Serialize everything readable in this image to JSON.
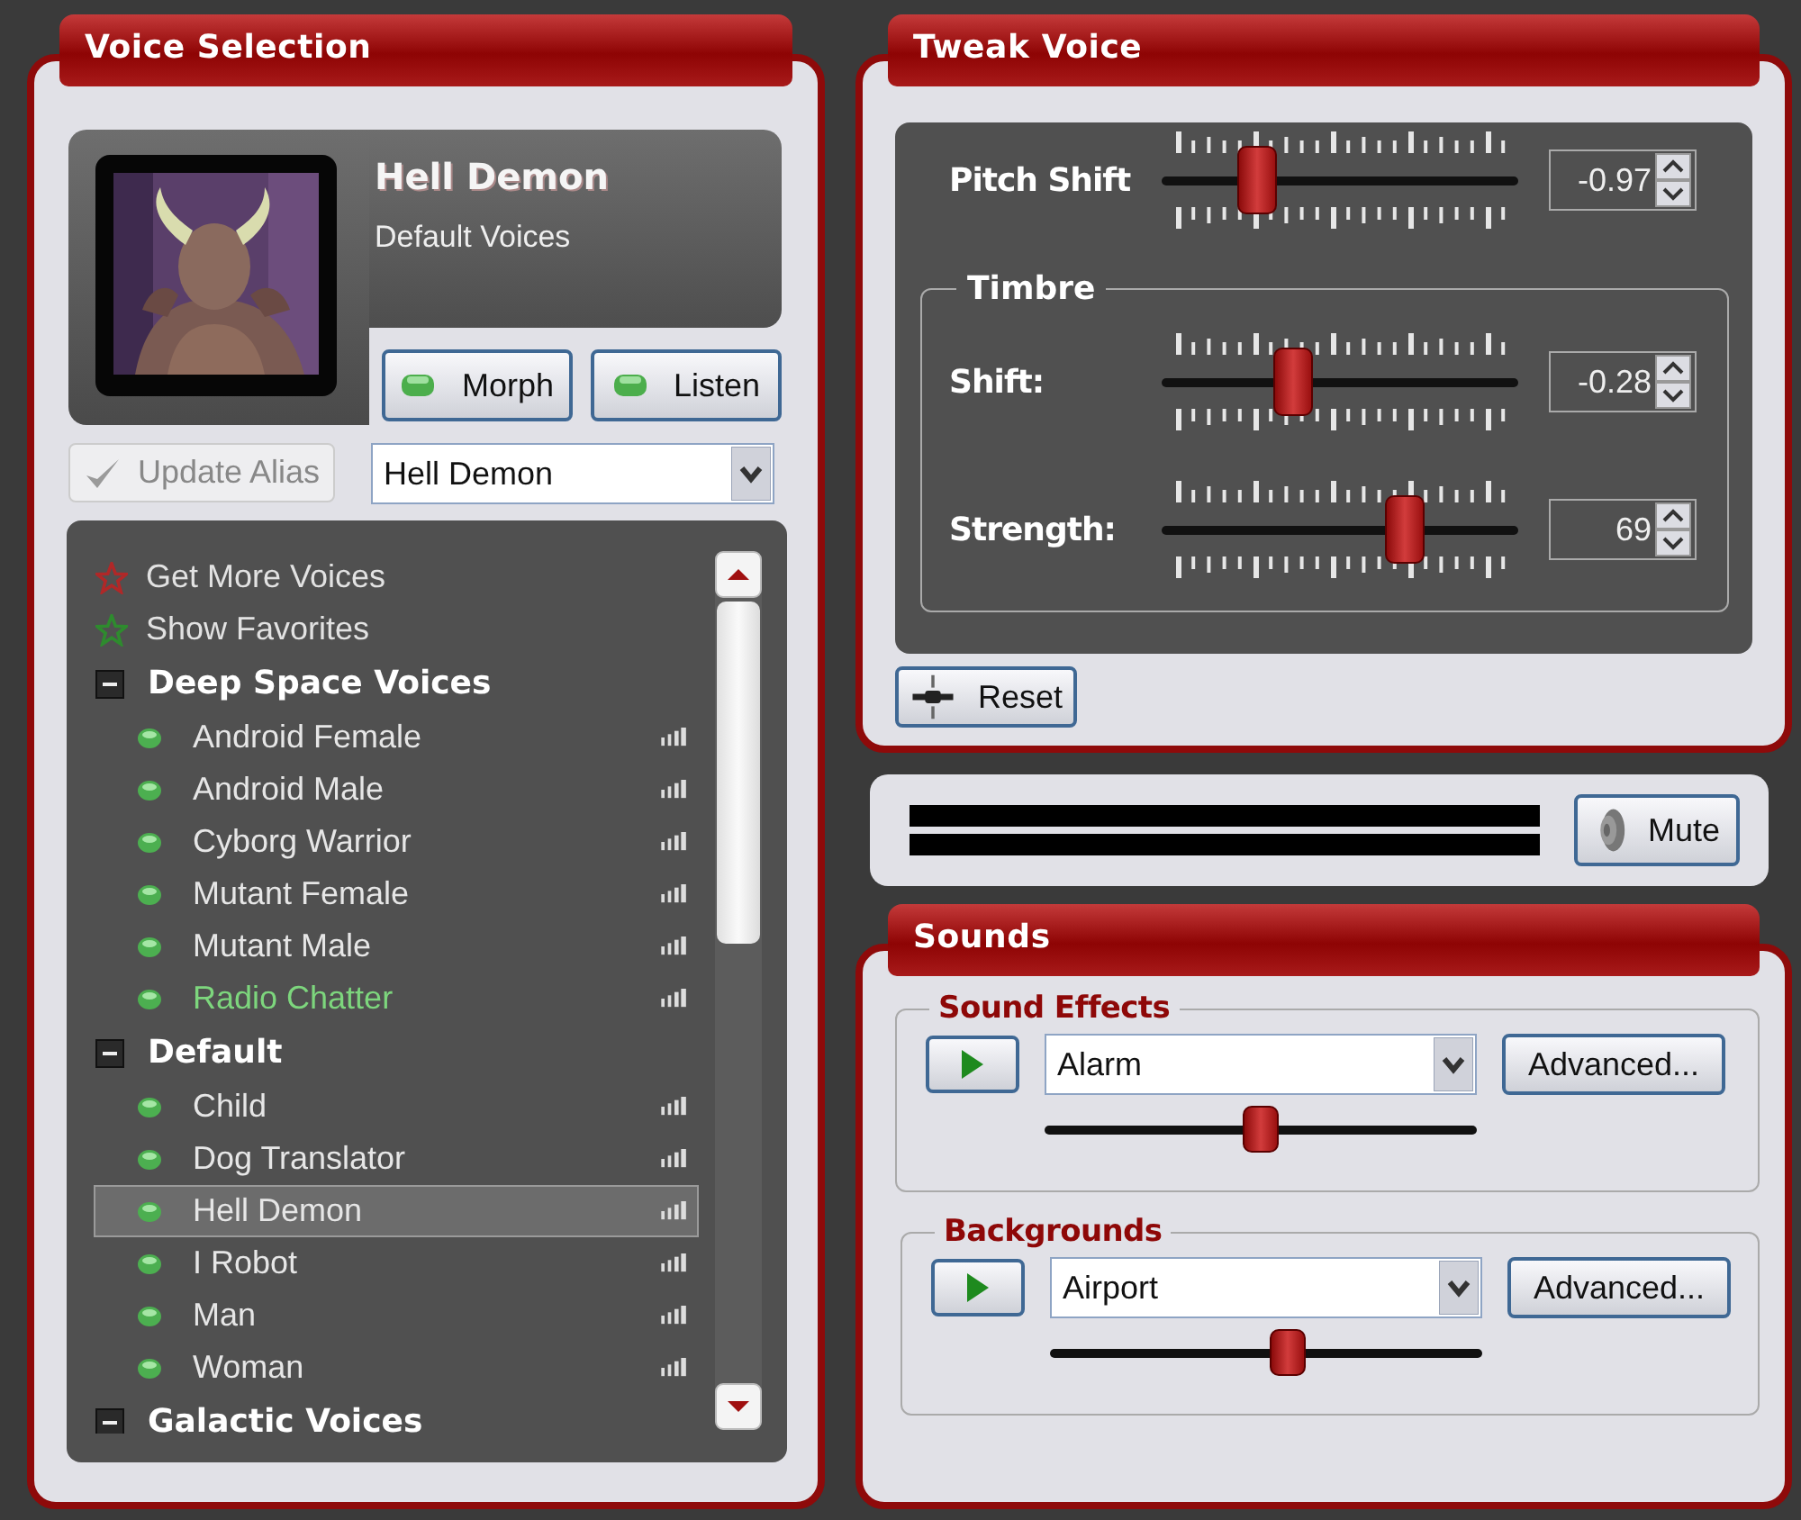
{
  "voice_selection": {
    "title": "Voice Selection",
    "voice_name": "Hell Demon",
    "voice_category": "Default Voices",
    "morph_button": "Morph",
    "listen_button": "Listen",
    "update_alias": {
      "label": "Update Alias",
      "disabled": true
    },
    "alias_dropdown": {
      "value": "Hell Demon"
    },
    "voice_list": {
      "links": [
        {
          "label": "Get More Voices",
          "color": "#b02828"
        },
        {
          "label": "Show Favorites",
          "color": "#2e8b2e"
        }
      ],
      "groups": [
        {
          "label": "Deep Space Voices",
          "expanded": true,
          "children": [
            {
              "label": "Android Female",
              "selected": false,
              "highlighted": false
            },
            {
              "label": "Android Male",
              "selected": false,
              "highlighted": false
            },
            {
              "label": "Cyborg Warrior",
              "selected": false,
              "highlighted": false
            },
            {
              "label": "Mutant Female",
              "selected": false,
              "highlighted": false
            },
            {
              "label": "Mutant Male",
              "selected": false,
              "highlighted": false
            },
            {
              "label": "Radio Chatter",
              "selected": false,
              "highlighted": true
            }
          ]
        },
        {
          "label": "Default",
          "expanded": true,
          "children": [
            {
              "label": "Child",
              "selected": false,
              "highlighted": false
            },
            {
              "label": "Dog Translator",
              "selected": false,
              "highlighted": false
            },
            {
              "label": "Hell Demon",
              "selected": true,
              "highlighted": false
            },
            {
              "label": "I Robot",
              "selected": false,
              "highlighted": false
            },
            {
              "label": "Man",
              "selected": false,
              "highlighted": false
            },
            {
              "label": "Woman",
              "selected": false,
              "highlighted": false
            }
          ]
        },
        {
          "label": "Galactic Voices",
          "expanded": true
        }
      ]
    }
  },
  "tweak_voice": {
    "title": "Tweak Voice",
    "pitch_shift": {
      "label": "Pitch Shift",
      "level": 0.27,
      "value": "-0.97"
    },
    "timbre": {
      "title": "Timbre",
      "sliders": [
        {
          "label": "Shift:",
          "level": 0.37,
          "value": "-0.28"
        },
        {
          "label": "Strength:",
          "level": 0.68,
          "value": "69"
        }
      ]
    },
    "reset_button": "Reset"
  },
  "output": {
    "mute_button": "Mute"
  },
  "sounds": {
    "title": "Sounds",
    "sections": [
      {
        "title": "Sound Effects",
        "value": "Alarm",
        "level": 0.5,
        "advanced_button": "Advanced..."
      },
      {
        "title": "Backgrounds",
        "value": "Airport",
        "level": 0.55,
        "advanced_button": "Advanced..."
      }
    ]
  }
}
